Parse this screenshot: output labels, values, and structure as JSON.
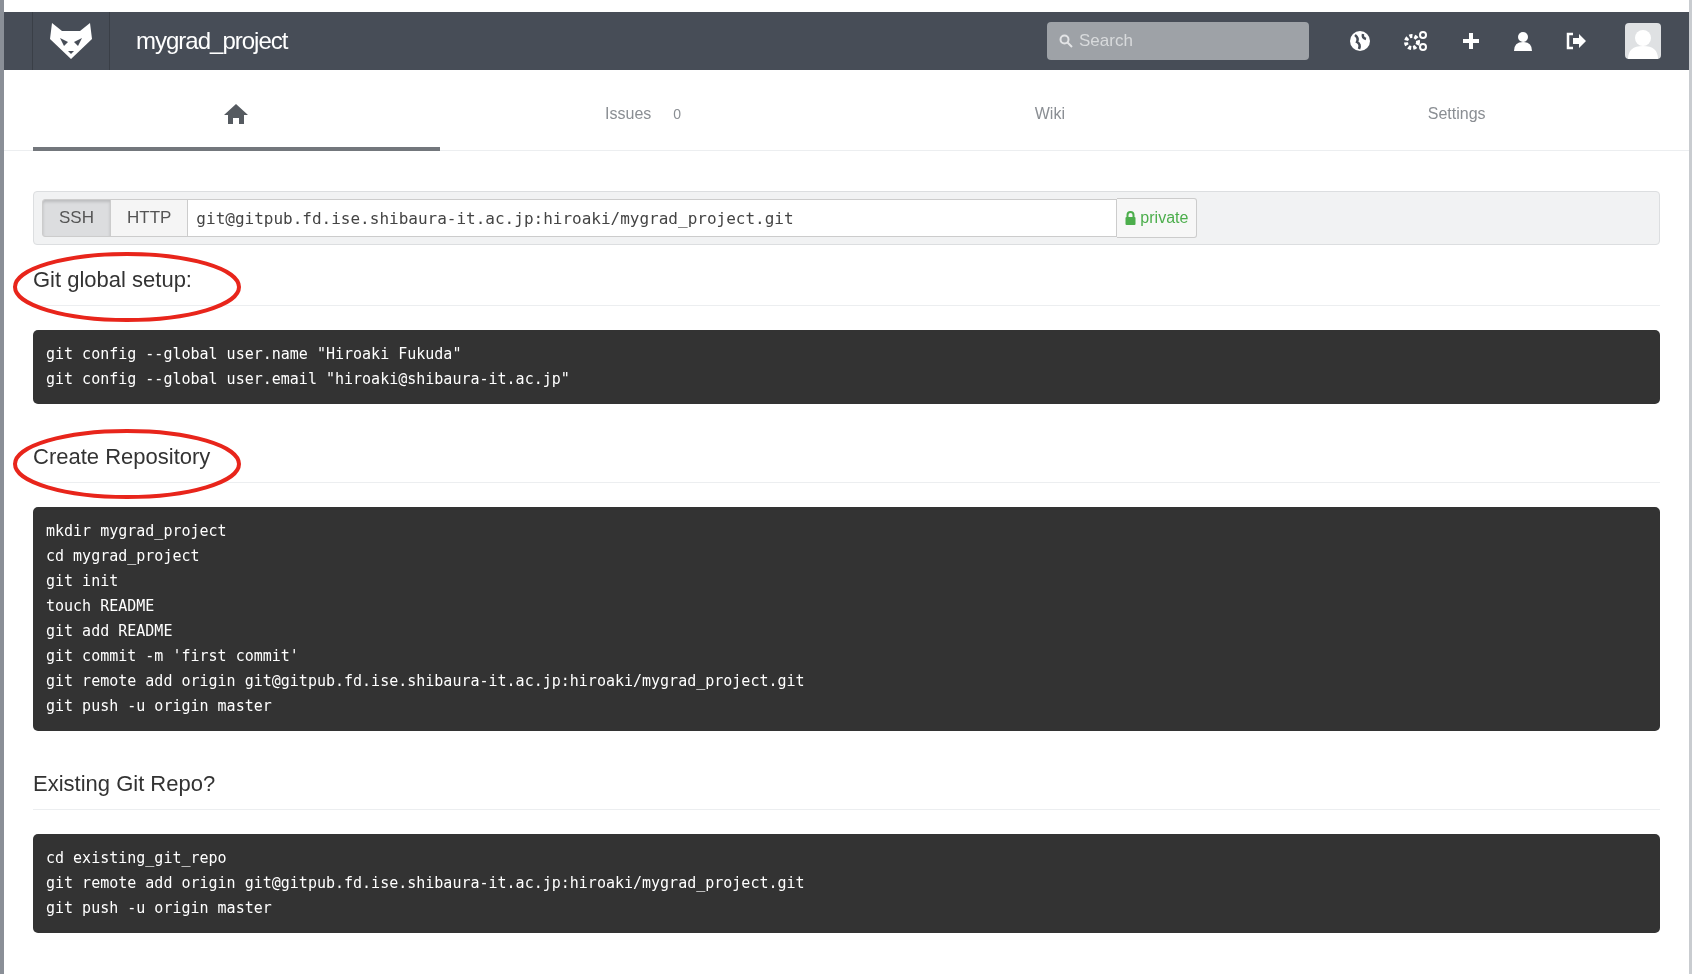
{
  "header": {
    "project": "mygrad_project",
    "search": {
      "placeholder": "Search"
    }
  },
  "tabs": [
    {
      "kind": "home",
      "selected": true
    },
    {
      "kind": "text",
      "label": "Issues",
      "count": "0",
      "selected": false
    },
    {
      "kind": "text",
      "label": "Wiki",
      "selected": false
    },
    {
      "kind": "text",
      "label": "Settings",
      "selected": false
    }
  ],
  "clone": {
    "protocols": [
      {
        "label": "SSH",
        "selected": true
      },
      {
        "label": "HTTP",
        "selected": false
      }
    ],
    "url": "git@gitpub.fd.ise.shibaura-it.ac.jp:hiroaki/mygrad_project.git",
    "visibility": "private"
  },
  "sections": [
    {
      "title": "Git global setup:",
      "circled": true,
      "code": [
        "git config --global user.name \"Hiroaki Fukuda\"",
        "git config --global user.email \"hiroaki@shibaura-it.ac.jp\""
      ]
    },
    {
      "title": "Create Repository",
      "circled": true,
      "code": [
        "mkdir mygrad_project",
        "cd mygrad_project",
        "git init",
        "touch README",
        "git add README",
        "git commit -m 'first commit'",
        "git remote add origin git@gitpub.fd.ise.shibaura-it.ac.jp:hiroaki/mygrad_project.git",
        "git push -u origin master"
      ]
    },
    {
      "title": "Existing Git Repo?",
      "circled": false,
      "code": [
        "cd existing_git_repo",
        "git remote add origin git@gitpub.fd.ise.shibaura-it.ac.jp:hiroaki/mygrad_project.git",
        "git push -u origin master"
      ]
    }
  ]
}
